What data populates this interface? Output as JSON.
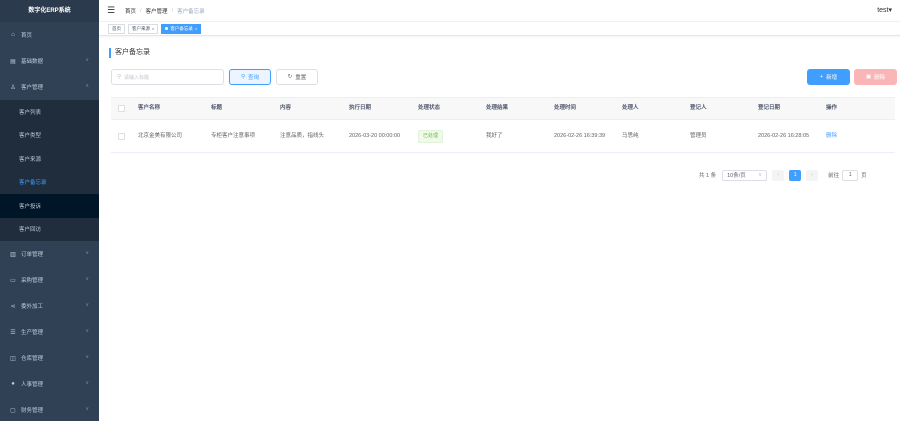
{
  "app": {
    "title": "数字化ERP系统",
    "user": "test"
  },
  "sidebar": {
    "items": [
      {
        "label": "首页",
        "icon": "home-icon",
        "glyph": "⌂",
        "has_children": false
      },
      {
        "label": "基础数据",
        "icon": "document-icon",
        "glyph": "▤",
        "has_children": true
      },
      {
        "label": "客户管理",
        "icon": "user-icon",
        "glyph": "♙",
        "has_children": true,
        "expanded": true
      },
      {
        "label": "订单管理",
        "icon": "order-icon",
        "glyph": "▥",
        "has_children": true
      },
      {
        "label": "采购管理",
        "icon": "monitor-icon",
        "glyph": "▭",
        "has_children": true
      },
      {
        "label": "委外加工",
        "icon": "share-icon",
        "glyph": "⋖",
        "has_children": true
      },
      {
        "label": "生产管理",
        "icon": "settings-icon",
        "glyph": "☰",
        "has_children": true
      },
      {
        "label": "仓库管理",
        "icon": "warehouse-icon",
        "glyph": "◫",
        "has_children": true
      },
      {
        "label": "人事管理",
        "icon": "person-icon",
        "glyph": "●",
        "has_children": true
      },
      {
        "label": "财务管理",
        "icon": "folder-icon",
        "glyph": "▢",
        "has_children": true
      }
    ],
    "sub_items": [
      {
        "label": "客户列表"
      },
      {
        "label": "客户类型"
      },
      {
        "label": "客户来源"
      },
      {
        "label": "客户备忘录",
        "active": true
      },
      {
        "label": "客户投诉"
      },
      {
        "label": "客户回访"
      }
    ]
  },
  "breadcrumb": [
    "首页",
    "客户管理",
    "客户备忘录"
  ],
  "tags": [
    {
      "label": "首页",
      "active": false,
      "closable": false
    },
    {
      "label": "客户来源",
      "active": false,
      "closable": true
    },
    {
      "label": "客户备忘录",
      "active": true,
      "closable": true
    }
  ],
  "page": {
    "title": "客户备忘录"
  },
  "toolbar": {
    "search_placeholder": "请输入标题",
    "query_label": "查询",
    "reset_label": "重置",
    "add_label": "新增",
    "delete_label": "删除"
  },
  "table": {
    "columns": [
      "客户名称",
      "标题",
      "内容",
      "执行日期",
      "处理状态",
      "处理结果",
      "处理时间",
      "处理人",
      "登记人",
      "登记日期",
      "操作"
    ],
    "rows": [
      {
        "customer": "北京金美有限公司",
        "title": "专柜客户注意事项",
        "content": "注意品质，指线头",
        "exec_date": "2026-03-20 00:00:00",
        "status": "已处理",
        "result": "我好了",
        "handle_time": "2026-02-26 16:39:39",
        "handler": "马思纯",
        "registrar": "管理员",
        "reg_date": "2026-02-26 16:28:05",
        "action": "删除"
      }
    ]
  },
  "pagination": {
    "total_text": "共 1 条",
    "page_size": "10条/页",
    "current_page": "1",
    "goto_label": "前往",
    "goto_value": "1",
    "goto_suffix": "页"
  },
  "colors": {
    "sidebar_bg": "#304156",
    "accent": "#409eff",
    "danger_light": "#fab6b6",
    "success": "#67c23a"
  }
}
